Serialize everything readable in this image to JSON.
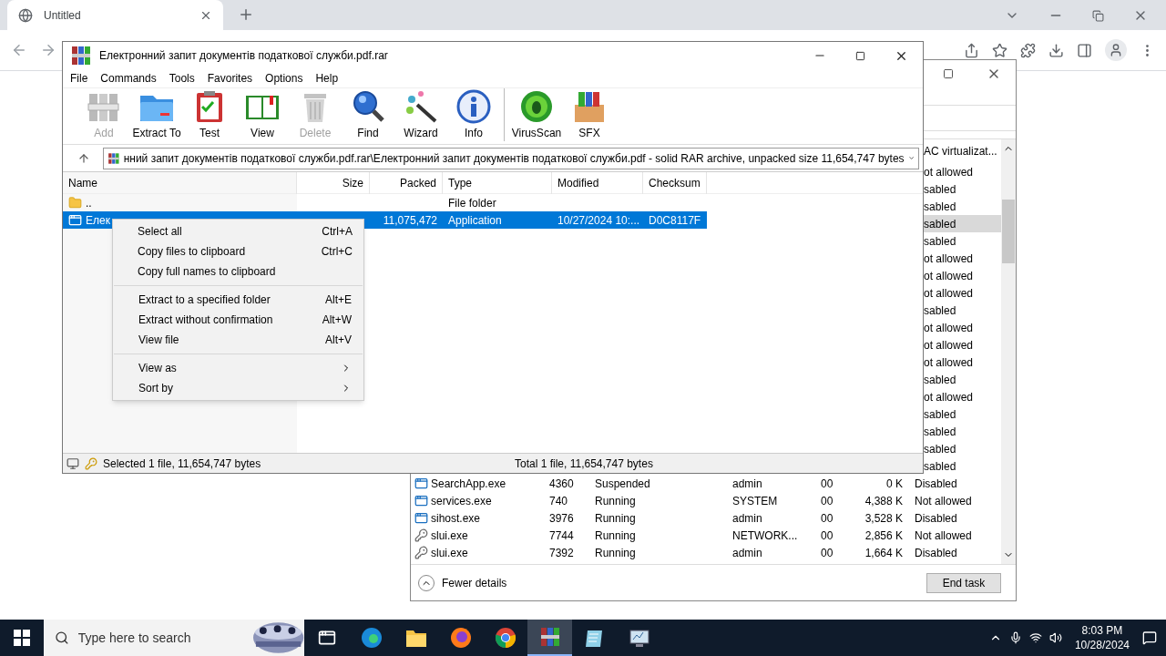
{
  "browser": {
    "tab": {
      "title": "Untitled"
    }
  },
  "task_manager": {
    "column_header": "AC virtualizat...",
    "rows": [
      {
        "uac": "ot allowed",
        "selected": false
      },
      {
        "uac": "sabled",
        "selected": false
      },
      {
        "uac": "sabled",
        "selected": false
      },
      {
        "uac": "sabled",
        "selected": true
      },
      {
        "uac": "sabled",
        "selected": false
      },
      {
        "uac": "ot allowed",
        "selected": false
      },
      {
        "uac": "ot allowed",
        "selected": false
      },
      {
        "uac": "ot allowed",
        "selected": false
      },
      {
        "uac": "sabled",
        "selected": false
      },
      {
        "uac": "ot allowed",
        "selected": false
      },
      {
        "uac": "ot allowed",
        "selected": false
      },
      {
        "uac": "ot allowed",
        "selected": false
      },
      {
        "uac": "sabled",
        "selected": false
      },
      {
        "uac": "ot allowed",
        "selected": false
      },
      {
        "uac": "sabled",
        "selected": false
      },
      {
        "uac": "sabled",
        "selected": false
      },
      {
        "uac": "sabled",
        "selected": false
      },
      {
        "uac": "sabled",
        "selected": false
      },
      {
        "kind": "app",
        "name": "SearchApp.exe",
        "pid": "4360",
        "status": "Suspended",
        "user": "admin",
        "cpu": "00",
        "memory": "0 K",
        "uac": "Disabled",
        "selected": false
      },
      {
        "kind": "app",
        "name": "services.exe",
        "pid": "740",
        "status": "Running",
        "user": "SYSTEM",
        "cpu": "00",
        "memory": "4,388 K",
        "uac": "Not allowed",
        "selected": false
      },
      {
        "kind": "app",
        "name": "sihost.exe",
        "pid": "3976",
        "status": "Running",
        "user": "admin",
        "cpu": "00",
        "memory": "3,528 K",
        "uac": "Disabled",
        "selected": false
      },
      {
        "kind": "key",
        "name": "slui.exe",
        "pid": "7744",
        "status": "Running",
        "user": "NETWORK...",
        "cpu": "00",
        "memory": "2,856 K",
        "uac": "Not allowed",
        "selected": false
      },
      {
        "kind": "key",
        "name": "slui.exe",
        "pid": "7392",
        "status": "Running",
        "user": "admin",
        "cpu": "00",
        "memory": "1,664 K",
        "uac": "Disabled",
        "selected": false
      }
    ],
    "footer": {
      "toggle": "Fewer details",
      "button": "End task"
    }
  },
  "winrar": {
    "title": "Електронний запит документів податкової служби.pdf.rar",
    "menu": [
      "File",
      "Commands",
      "Tools",
      "Favorites",
      "Options",
      "Help"
    ],
    "toolbar": [
      [
        {
          "kind": "add",
          "label": "Add",
          "disabled": true
        },
        {
          "kind": "extract",
          "label": "Extract To",
          "disabled": false
        },
        {
          "kind": "test",
          "label": "Test",
          "disabled": false
        },
        {
          "kind": "view",
          "label": "View",
          "disabled": false
        },
        {
          "kind": "delete",
          "label": "Delete",
          "disabled": true
        },
        {
          "kind": "find",
          "label": "Find",
          "disabled": false
        },
        {
          "kind": "wizard",
          "label": "Wizard",
          "disabled": false
        },
        {
          "kind": "info",
          "label": "Info",
          "disabled": false
        }
      ],
      [
        {
          "kind": "virus",
          "label": "VirusScan",
          "disabled": false
        },
        {
          "kind": "sfx",
          "label": "SFX",
          "disabled": false
        }
      ]
    ],
    "address": "нний запит документів податкової служби.pdf.rar\\Електронний запит документів податкової служби.pdf - solid RAR archive, unpacked size 11,654,747 bytes",
    "columns": [
      "Name",
      "Size",
      "Packed",
      "Type",
      "Modified",
      "Checksum"
    ],
    "rows": [
      {
        "kind": "folder",
        "name": "..",
        "type": "File folder",
        "selected": false
      },
      {
        "kind": "file",
        "name": "Елек",
        "packed": "11,075,472",
        "type": "Application",
        "modified": "10/27/2024 10:...",
        "checksum": "D0C8117F",
        "selected": true
      }
    ],
    "status": {
      "selected": "Selected 1 file, 11,654,747 bytes",
      "total": "Total 1 file, 11,654,747 bytes"
    }
  },
  "context_menu": [
    [
      {
        "label": "Select all",
        "shortcut": "Ctrl+A",
        "submenu": false
      },
      {
        "label": "Copy files to clipboard",
        "shortcut": "Ctrl+C",
        "submenu": false
      },
      {
        "label": "Copy full names to clipboard",
        "submenu": false
      }
    ],
    [
      {
        "label": "Extract to a specified folder",
        "shortcut": "Alt+E",
        "submenu": false
      },
      {
        "label": "Extract without confirmation",
        "shortcut": "Alt+W",
        "submenu": false
      },
      {
        "label": "View file",
        "shortcut": "Alt+V",
        "submenu": false
      }
    ],
    [
      {
        "label": "View as",
        "submenu": true
      },
      {
        "label": "Sort by",
        "submenu": true
      }
    ]
  ],
  "taskbar": {
    "search": {
      "placeholder": "Type here to search"
    },
    "apps": [
      {
        "kind": "taskview",
        "active": false
      },
      {
        "kind": "edge",
        "active": false
      },
      {
        "kind": "explorer",
        "active": false
      },
      {
        "kind": "firefox",
        "active": false
      },
      {
        "kind": "chrome",
        "active": false
      },
      {
        "kind": "winrar",
        "active": true
      },
      {
        "kind": "notepad",
        "active": false
      },
      {
        "kind": "monitor",
        "active": false
      }
    ],
    "time": "8:03 PM",
    "date": "10/28/2024"
  }
}
